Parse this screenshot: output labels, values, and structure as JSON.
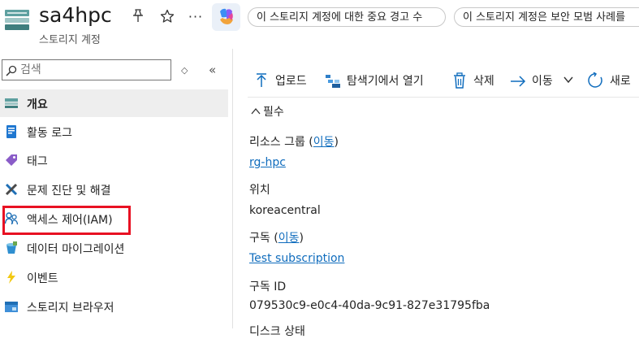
{
  "header": {
    "title": "sa4hpc",
    "subtitle": "스토리지 계정",
    "more": "···",
    "alerts": [
      "이 스토리지 계정에 대한 중요 경고 수",
      "이 스토리지 계정은 보안 모범 사례를"
    ]
  },
  "search": {
    "placeholder": "검색",
    "sort_symbol": "◇",
    "collapse_symbol": "«"
  },
  "sidebar": {
    "items": [
      {
        "label": "개요",
        "icon": "storage-icon"
      },
      {
        "label": "활동 로그",
        "icon": "activity-log-icon"
      },
      {
        "label": "태그",
        "icon": "tag-icon"
      },
      {
        "label": "문제 진단 및 해결",
        "icon": "wrench-icon"
      },
      {
        "label": "액세스 제어(IAM)",
        "icon": "people-icon"
      },
      {
        "label": "데이터 마이그레이션",
        "icon": "bucket-icon"
      },
      {
        "label": "이벤트",
        "icon": "lightning-icon"
      },
      {
        "label": "스토리지 브라우저",
        "icon": "folder-icon"
      }
    ],
    "selected": "개요",
    "highlighted": "액세스 제어(IAM)"
  },
  "toolbar": {
    "upload": "업로드",
    "explorer": "탐색기에서 열기",
    "delete": "삭제",
    "move": "이동",
    "refresh": "새로"
  },
  "essentials": {
    "toggle": "필수",
    "resource_group_label": "리소스 그룹",
    "move_link": "이동",
    "resource_group_value": "rg-hpc",
    "location_label": "위치",
    "location_value": "koreacentral",
    "subscription_label": "구독",
    "subscription_value": "Test subscription",
    "subscription_id_label": "구독 ID",
    "subscription_id_value": "079530c9-e0c4-40da-9c91-827e31795fba",
    "cut_label": "디스크 상태"
  },
  "colors": {
    "link": "#0f6cbd",
    "highlight_border": "#e81123",
    "selected_bg": "#eeeeee",
    "accent": "#0f6cbd"
  }
}
